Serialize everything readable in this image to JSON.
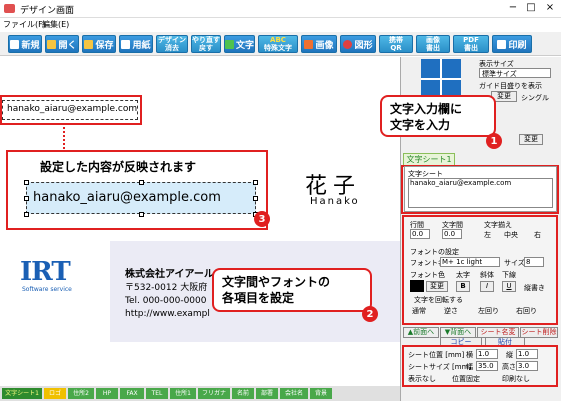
{
  "window": {
    "title": "デザイン画面"
  },
  "menu": [
    {
      "label": "ファイル(F)"
    },
    {
      "label": "編集(E)"
    }
  ],
  "toolbar": {
    "new": "新規",
    "open": "開く",
    "save": "保存",
    "paper": "用紙",
    "clear_design": "デザイン\n消去",
    "undo_redo": "やり直す\n戻す",
    "text": "文字",
    "special_text": "特殊文字",
    "special_text_top": "ABC",
    "image": "画像",
    "shape": "図形",
    "qr": "携帯\nQR",
    "image_insert": "画像\n書出",
    "pdf": "PDF\n書出",
    "print": "印刷"
  },
  "card": {
    "email_small": "hanako_aiaru@example.com",
    "email_large": "hanako_aiaru@example.com",
    "name_kanji": "花子",
    "name_romaji": "Hanako",
    "logo_main": "IRT",
    "logo_sub": "Software service",
    "company": "株式会社アイアールティー",
    "address": "〒532-0012 大阪府",
    "tel": "Tel. 000-000-0000",
    "url": "http://www.exampl"
  },
  "annotations": {
    "bubble1": "文字入力欄に\n文字を入力",
    "bubble2": "文字間やフォントの\n各項目を設定",
    "big_callout_title": "設定した内容が反映されます",
    "badge1": "1",
    "badge2": "2",
    "badge3": "3"
  },
  "right_panel": {
    "display_size_label": "表示サイズ",
    "display_size_value": "標準サイズ",
    "show_guide": "ガイド目盛りを表示",
    "change_btn": "変更",
    "single": "シングル",
    "tab_label": "文字シート1",
    "sheet_label": "文字シート",
    "sheet_value": "hanako_aiaru@example.com",
    "line_spacing_label": "行間",
    "char_spacing_label": "文字間",
    "align_label": "文字揃え",
    "line_spacing_value": "0.0",
    "char_spacing_value": "0.0",
    "align_left": "左",
    "align_center": "中央",
    "align_right": "右",
    "font_settings": "フォントの設定",
    "font_name_label": "フォント名",
    "font_name_value": "M+ 1c light",
    "size_label": "サイズ",
    "size_value": "8",
    "font_color": "フォント色",
    "bold_label": "太字",
    "italic_label": "斜体",
    "underline_label": "下線",
    "color_change": "変更",
    "bold_btn": "B",
    "italic_btn": "I",
    "underline_btn": "U",
    "vertical": "縦書き",
    "rotate_label": "文字を回転する",
    "rotate_off": "通常",
    "rotate_180": "逆さ",
    "rotate_left": "左回り",
    "rotate_right": "右回り",
    "front": "▲前面へ",
    "back": "▼背面へ",
    "rename": "シート名変更",
    "delete": "シート削除",
    "copy": "コピー",
    "paste": "貼付",
    "pos_label": "シート位置 [mm]",
    "horiz": "横",
    "vert": "縦",
    "pos_h": "1.0",
    "pos_v": "1.0",
    "size_mm": "シートサイズ [mm]",
    "width_label": "幅",
    "height_label": "高さ",
    "width_val": "35.0",
    "height_val": "3.0",
    "hide": "表示なし",
    "fix_pos": "位置固定",
    "no_print": "印刷なし"
  },
  "bottom_tabs": [
    "文字シート1",
    "ロゴ",
    "住所2",
    "HP",
    "FAX",
    "TEL",
    "住所1",
    "フリガナ",
    "名前",
    "部署",
    "会社名",
    "背景"
  ],
  "colors": {
    "accent_red": "#e02020",
    "toolbar_blue": "#1f74bd",
    "tab_green": "#49a84a"
  }
}
